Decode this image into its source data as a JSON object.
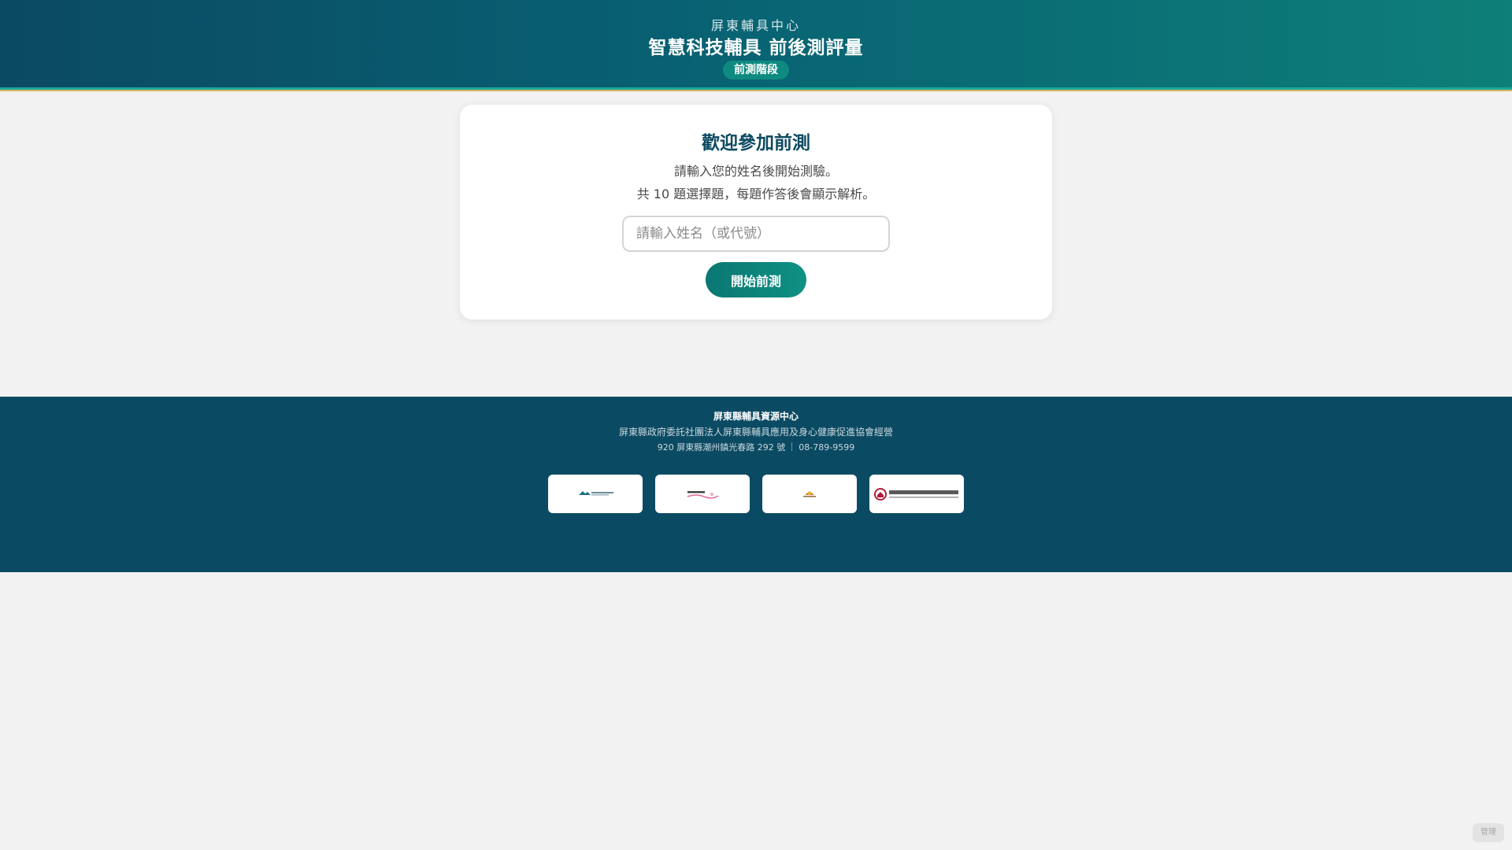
{
  "header": {
    "subtitle": "屏東輔具中心",
    "title": "智慧科技輔具 前後測評量",
    "stage_badge": "前測階段"
  },
  "card": {
    "title": "歡迎參加前測",
    "line1": "請輸入您的姓名後開始測驗。",
    "line2": "共 10 題選擇題，每題作答後會顯示解析。",
    "name_placeholder": "請輸入姓名（或代號）",
    "name_value": "",
    "start_button": "開始前測"
  },
  "footer": {
    "org": "屏東縣輔具資源中心",
    "desc": "屏東縣政府委託社團法人屏東縣輔具應用及身心健康促進協會經營",
    "address": "920 屏東縣潮州鎮光春路 292 號",
    "phone": "08-789-9599",
    "logos": [
      "partner-logo-1",
      "partner-logo-2",
      "partner-logo-3",
      "partner-logo-4"
    ]
  },
  "admin_button": "管理",
  "colors": {
    "header_start": "#0b4a63",
    "header_end": "#0e7f79",
    "accent_teal": "#0e8a80",
    "gold_stripe": "#d6b35a",
    "footer_bg": "#0b4a63",
    "card_title": "#0c4a60"
  }
}
